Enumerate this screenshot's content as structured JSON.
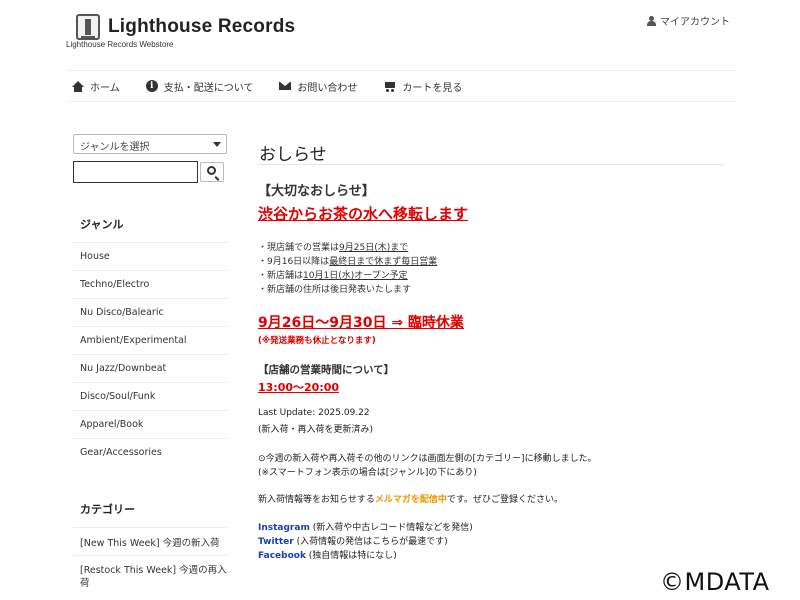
{
  "header": {
    "logo_text": "Lighthouse Records",
    "logo_sub": "Lighthouse Records Webstore",
    "account_label": "マイアカウント"
  },
  "nav": {
    "home": "ホーム",
    "payment": "支払・配送について",
    "contact": "お問い合わせ",
    "cart": "カートを見る"
  },
  "sidebar": {
    "genre_select": "ジャンルを選択",
    "search_value": "",
    "genre_heading": "ジャンル",
    "genres": [
      "House",
      "Techno/Electro",
      "Nu Disco/Balearic",
      "Ambient/Experimental",
      "Nu Jazz/Downbeat",
      "Disco/Soul/Funk",
      "Apparel/Book",
      "Gear/Accessories"
    ],
    "category_heading": "カテゴリー",
    "categories": [
      "[New This Week] 今週の新入荷",
      "[Restock This Week] 今週の再入荷"
    ]
  },
  "main": {
    "title": "おしらせ",
    "notice_head": "【大切なおしらせ】",
    "move_head": "渋谷からお茶の水へ移転します",
    "bullets": [
      {
        "pre": "・現店舗での営業は",
        "u": "9月25日(木)まで",
        "post": ""
      },
      {
        "pre": "・9月16日以降は",
        "u": "最終日まで休まず毎日営業",
        "post": ""
      },
      {
        "pre": "・新店舗は",
        "u": "10月1日(水)オープン予定",
        "post": ""
      },
      {
        "pre": "・新店舗の住所は後日発表いたします",
        "u": "",
        "post": ""
      }
    ],
    "closure": "9月26日～9月30日 ⇒ 臨時休業",
    "closure_note": "(※発送業務も休止となります)",
    "hours_head": "【店舗の営業時間について】",
    "hours": "13:00～20:00",
    "last_update": "Last Update: 2025.09.22",
    "update_note": "(新入荷・再入荷を更新済み)",
    "link_note1": "⊙今週の新入荷や再入荷その他のリンクは画面左側の[カテゴリー]に移動しました。",
    "link_note2": "(※スマートフォン表示の場合は[ジャンル]の下にあり)",
    "mail_pre": "新入荷情報等をお知らせする",
    "mail_link": "メルマガを配信中",
    "mail_post": "です。ぜひご登録ください。",
    "social": [
      {
        "name": "Instagram",
        "desc": " (新入荷や中古レコード情報などを発信)"
      },
      {
        "name": "Twitter",
        "desc": " (入荷情報の発信はこちらが最速です)"
      },
      {
        "name": "Facebook",
        "desc": " (独自情報は特になし)"
      }
    ]
  },
  "watermark": "©MDATA"
}
